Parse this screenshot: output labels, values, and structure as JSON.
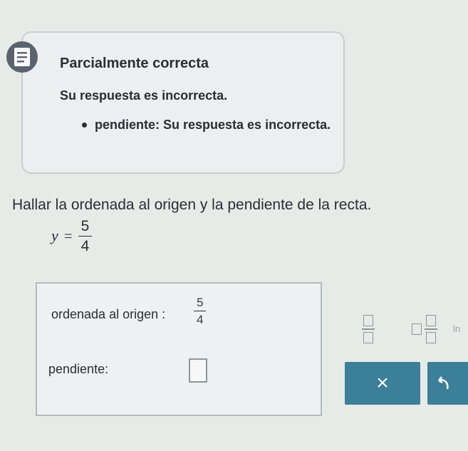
{
  "feedback": {
    "status": "Parcialmente correcta",
    "headline": "Su respuesta es incorrecta.",
    "items": [
      {
        "label": "pendiente: Su respuesta es incorrecta."
      }
    ],
    "icon": "feedback-document-icon"
  },
  "question": {
    "text": "Hallar la ordenada al origen y la pendiente de la recta.",
    "equation": {
      "var": "y",
      "eq": "=",
      "numerator": "5",
      "denominator": "4"
    }
  },
  "answers": {
    "ordenada": {
      "label": "ordenada al origen :",
      "numerator": "5",
      "denominator": "4"
    },
    "pendiente": {
      "label": "pendiente:",
      "value": ""
    }
  },
  "toolbar": {
    "fraction_icon": "fraction-template-icon",
    "mixed_icon": "mixed-number-template-icon",
    "ln_label": "ln",
    "clear_label": "×",
    "undo_icon": "undo-icon"
  },
  "colors": {
    "background": "#e7ebe8",
    "button": "#3c7f99",
    "icon": "#5a6470"
  }
}
